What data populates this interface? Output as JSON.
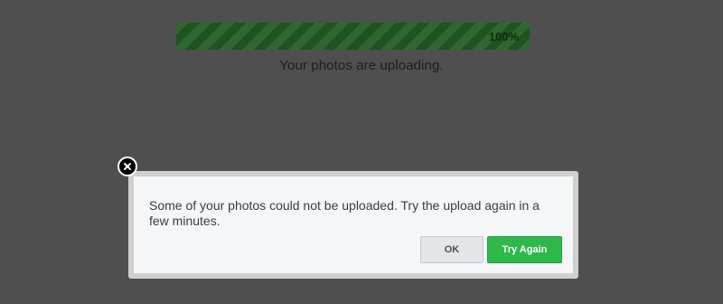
{
  "upload": {
    "progress_percent": 100,
    "progress_label": "100%",
    "status_text": "Your photos are uploading."
  },
  "dialog": {
    "message": "Some of your photos could not be uploaded. Try the upload again in a few minutes.",
    "ok_label": "OK",
    "try_again_label": "Try Again",
    "close_icon": "close-icon"
  },
  "colors": {
    "page_background": "#4f4f4f",
    "progress_fill": "#1f531f",
    "try_again_button": "#2fb84a",
    "ok_button": "#e4e5e7",
    "dialog_background": "#f5f6f8"
  }
}
